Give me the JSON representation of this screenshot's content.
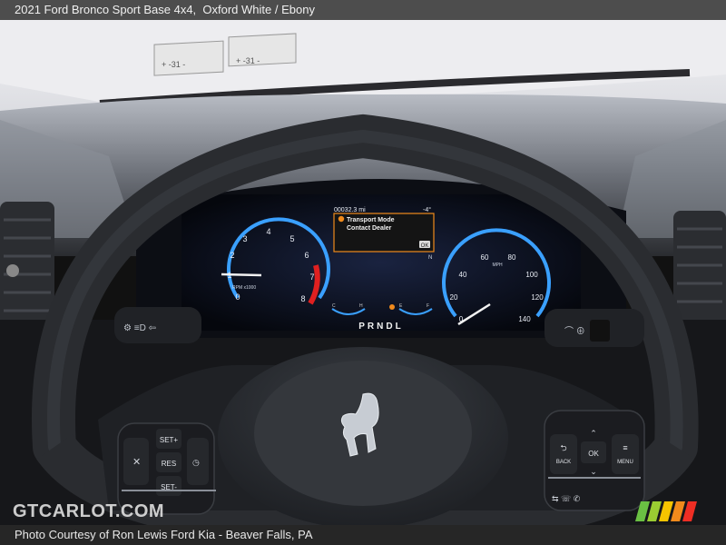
{
  "header": {
    "title": "2021 Ford Bronco Sport Base 4x4,  Oxford White / Ebony"
  },
  "photo": {
    "windshield_stickers": [
      "+ -31 -",
      "+ -31 -"
    ],
    "cluster": {
      "odometer": "00032.3 mi",
      "outside_temp": "-4°",
      "message_line1": "Transport Mode",
      "message_line2": "Contact Dealer",
      "ok_label": "OK",
      "compass": "N",
      "gear_indicator": "PRNDL",
      "tach_label": "RPM\nx1000",
      "tach_ticks": [
        "0",
        "1",
        "2",
        "3",
        "4",
        "5",
        "6",
        "7",
        "8"
      ],
      "speed_unit": "MPH",
      "speed_ticks": [
        "0",
        "20",
        "40",
        "60",
        "80",
        "100",
        "120",
        "140"
      ],
      "temp_gauge_labels": [
        "C",
        "H"
      ],
      "fuel_gauge_labels": [
        "E",
        "F"
      ]
    },
    "wheel": {
      "left_buttons": [
        "SET+",
        "RES",
        "SET-"
      ],
      "right_buttons": [
        "OK",
        "BACK",
        "MENU"
      ]
    }
  },
  "watermark": {
    "text": "GTCARLOT.COM"
  },
  "footer": {
    "credit": "Photo Courtesy of Ron Lewis Ford Kia - Beaver Falls, PA"
  },
  "colors": {
    "gauge_blue": "#3aa0ff",
    "redline": "#e02020",
    "message_orange": "#f08a1c",
    "stripe_colors": [
      "#6ac043",
      "#f5c400",
      "#f08a1c",
      "#ee2e24"
    ]
  }
}
